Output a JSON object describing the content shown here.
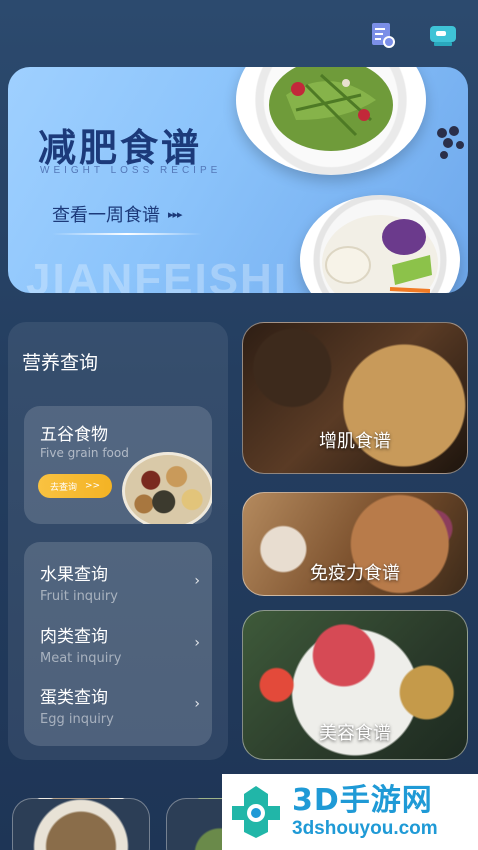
{
  "topbar": {
    "icons": [
      "recipe-list-icon",
      "chef-hat-icon"
    ]
  },
  "banner": {
    "title": "减肥食谱",
    "subtitle": "WEIGHT LOSS RECIPE",
    "week_button": "查看一周食谱",
    "week_button_arrows": "▸▸▸",
    "watermark": "JIANFEISHI"
  },
  "nutrition": {
    "heading": "营养查询",
    "grain": {
      "title": "五谷食物",
      "subtitle": "Five grain food",
      "button": "去查询",
      "button_arrows": ">>"
    },
    "inquiries": [
      {
        "title": "水果查询",
        "subtitle": "Fruit inquiry",
        "chevron": "›"
      },
      {
        "title": "肉类查询",
        "subtitle": "Meat inquiry",
        "chevron": "›"
      },
      {
        "title": "蛋类查询",
        "subtitle": "Egg inquiry",
        "chevron": "›"
      }
    ]
  },
  "recipes": [
    {
      "label": "增肌食谱"
    },
    {
      "label": "免疫力食谱"
    },
    {
      "label": "美容食谱"
    }
  ],
  "site_logo": {
    "big": "3D手游网",
    "small": "3dshouyou.com"
  },
  "colors": {
    "background": "#243e60",
    "banner_title": "#1c3a7a",
    "accent_button": "#f4b324",
    "logo_blue": "#1f9ad6"
  }
}
